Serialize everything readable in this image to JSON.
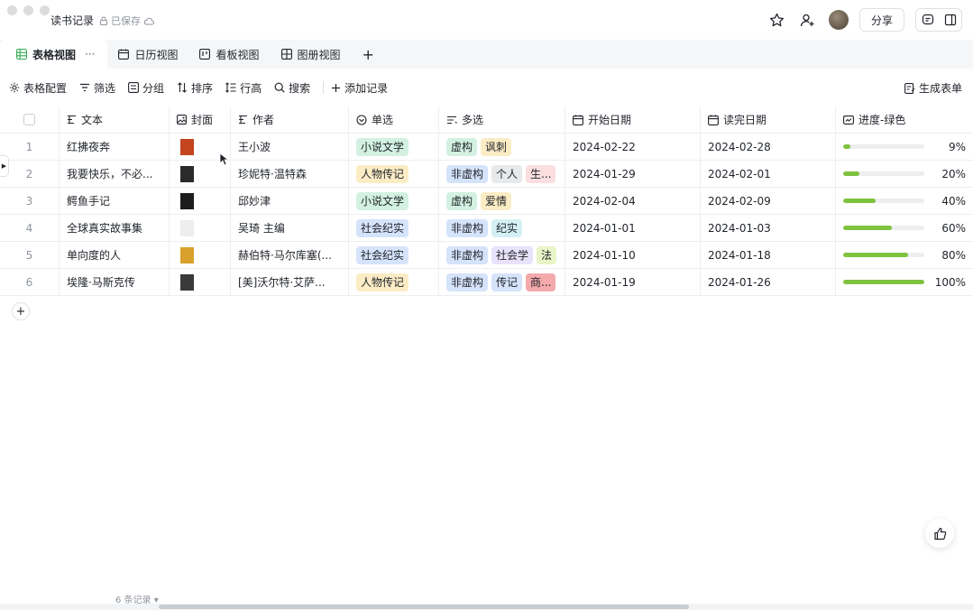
{
  "window": {
    "title": "读书记录",
    "saved_status": "已保存"
  },
  "header": {
    "share_label": "分享"
  },
  "tabs": [
    {
      "label": "表格视图",
      "icon": "table-icon",
      "active": true
    },
    {
      "label": "日历视图",
      "icon": "calendar-icon"
    },
    {
      "label": "看板视图",
      "icon": "kanban-icon"
    },
    {
      "label": "图册视图",
      "icon": "gallery-icon"
    }
  ],
  "tab_more": "···",
  "tab_add": "+",
  "toolbar": {
    "config": "表格配置",
    "filter": "筛选",
    "group": "分组",
    "sort": "排序",
    "row_height": "行高",
    "search": "搜索",
    "add_record": "添加记录",
    "generate_form": "生成表单"
  },
  "columns": [
    {
      "label": "文本",
      "icon": "text-icon"
    },
    {
      "label": "封面",
      "icon": "image-icon"
    },
    {
      "label": "作者",
      "icon": "text-icon"
    },
    {
      "label": "单选",
      "icon": "single-select-icon"
    },
    {
      "label": "多选",
      "icon": "multi-select-icon"
    },
    {
      "label": "开始日期",
      "icon": "date-icon"
    },
    {
      "label": "读完日期",
      "icon": "date-icon"
    },
    {
      "label": "进度-绿色",
      "icon": "progress-icon"
    }
  ],
  "rows": [
    {
      "num": "1",
      "title": "红拂夜奔",
      "author": "王小波",
      "single": "小说文学",
      "multi": [
        "虚构",
        "讽刺"
      ],
      "start": "2024-02-22",
      "end": "2024-02-28",
      "progress": 0.09,
      "progress_label": "9%",
      "cover_color": "#c2451f"
    },
    {
      "num": "2",
      "title": "我要快乐，不必...",
      "author": "珍妮特·温特森",
      "single": "人物传记",
      "multi": [
        "非虚构",
        "个人",
        "生..."
      ],
      "start": "2024-01-29",
      "end": "2024-02-01",
      "progress": 0.2,
      "progress_label": "20%",
      "cover_color": "#2a2a2a"
    },
    {
      "num": "3",
      "title": "鳄鱼手记",
      "author": "邱妙津",
      "single": "小说文学",
      "multi": [
        "虚构",
        "爱情"
      ],
      "start": "2024-02-04",
      "end": "2024-02-09",
      "progress": 0.4,
      "progress_label": "40%",
      "cover_color": "#1d1d1d"
    },
    {
      "num": "4",
      "title": "全球真实故事集",
      "author": "吴琦 主编",
      "single": "社会纪实",
      "multi": [
        "非虚构",
        "纪实"
      ],
      "start": "2024-01-01",
      "end": "2024-01-03",
      "progress": 0.6,
      "progress_label": "60%",
      "cover_color": "#eeeeee"
    },
    {
      "num": "5",
      "title": "单向度的人",
      "author": "赫伯特·马尔库塞(...",
      "single": "社会纪实",
      "multi": [
        "非虚构",
        "社会学",
        "法"
      ],
      "start": "2024-01-10",
      "end": "2024-01-18",
      "progress": 0.8,
      "progress_label": "80%",
      "cover_color": "#d9a12b"
    },
    {
      "num": "6",
      "title": "埃隆·马斯克传",
      "author": "[美]沃尔特·艾萨...",
      "single": "人物传记",
      "multi": [
        "非虚构",
        "传记",
        "商..."
      ],
      "start": "2024-01-19",
      "end": "2024-01-26",
      "progress": 1.0,
      "progress_label": "100%",
      "cover_color": "#3a3a3a"
    }
  ],
  "tag_colors": {
    "小说文学": "#d3f1e2",
    "人物传记": "#fbecc5",
    "社会纪实": "#d5e3fb",
    "虚构": "#d3f1e2",
    "讽刺": "#fbecc5",
    "非虚构": "#d5e3fb",
    "个人": "#e8e9eb",
    "生...": "#fbdede",
    "爱情": "#fbecc5",
    "纪实": "#d4f0f4",
    "社会学": "#e9e2fb",
    "法": "#eaf5c7",
    "传记": "#d5e3fb",
    "商...": "#f4a9ab"
  },
  "footer": {
    "record_count": "6 条记录"
  },
  "add_row_label": "+"
}
